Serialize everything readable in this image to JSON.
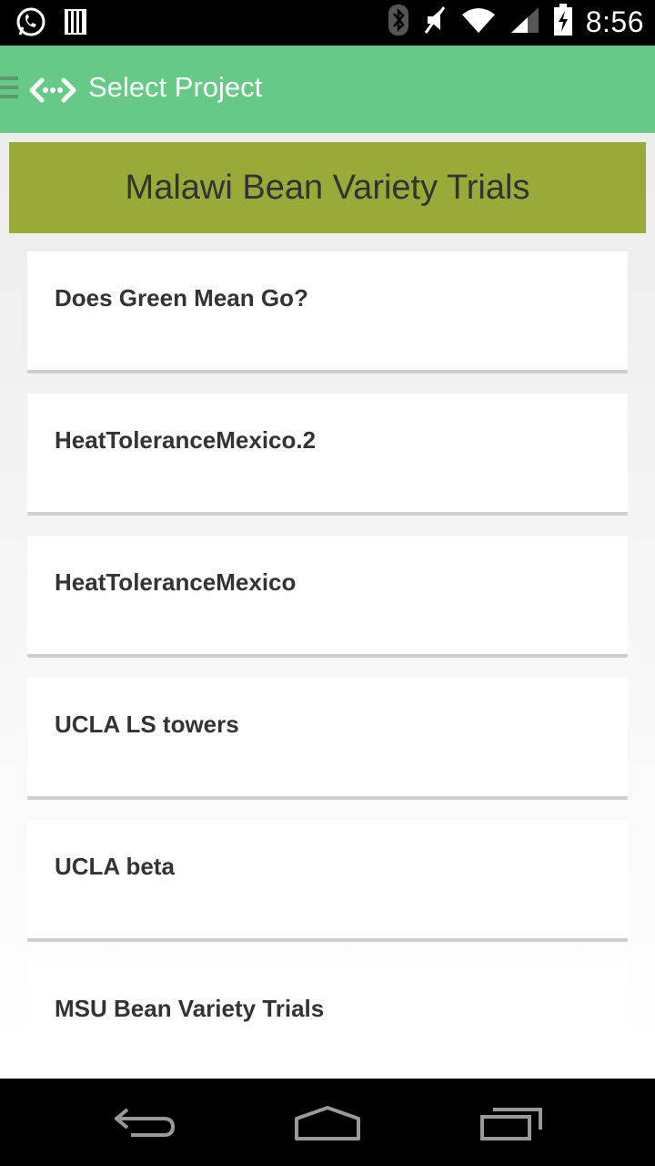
{
  "status_bar": {
    "time": "8:56",
    "left_icons": [
      "whatsapp-icon",
      "storage-icon"
    ],
    "right_icons": [
      "bluetooth-icon",
      "mute-icon",
      "wifi-icon",
      "signal-icon",
      "battery-icon"
    ]
  },
  "action_bar": {
    "title": "Select Project",
    "icon": "code-arrows-icon",
    "background": "#66c985"
  },
  "banner": {
    "title": "Malawi Bean Variety Trials",
    "background": "#99aa38"
  },
  "projects": [
    {
      "name": "Does Green Mean Go?"
    },
    {
      "name": "HeatToleranceMexico.2"
    },
    {
      "name": "HeatToleranceMexico"
    },
    {
      "name": "UCLA LS towers"
    },
    {
      "name": "UCLA beta"
    },
    {
      "name": "MSU Bean Variety Trials"
    }
  ],
  "nav_bar": {
    "buttons": [
      "back-icon",
      "home-icon",
      "recents-icon"
    ]
  }
}
